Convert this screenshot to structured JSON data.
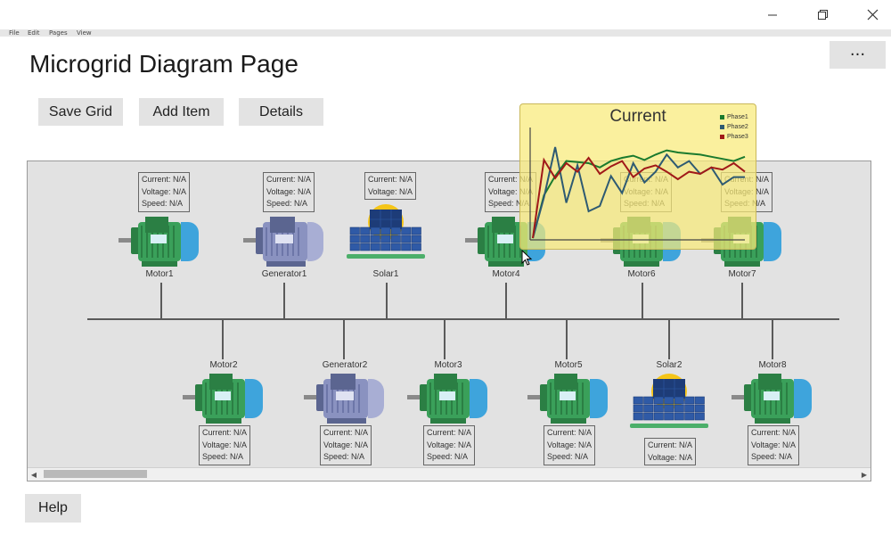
{
  "window": {
    "min_icon": "minimize-icon",
    "max_icon": "restore-icon",
    "close_icon": "close-icon"
  },
  "menu": [
    "File",
    "Edit",
    "Pages",
    "View"
  ],
  "page_title": "Microgrid Diagram Page",
  "toolbar": {
    "save": "Save Grid",
    "add": "Add Item",
    "details": "Details",
    "more": "···"
  },
  "help": "Help",
  "info_labels": {
    "current": "Current: N/A",
    "voltage": "Voltage: N/A",
    "speed": "Speed: N/A"
  },
  "devices_top": [
    {
      "name": "Motor1",
      "kind": "motor"
    },
    {
      "name": "Generator1",
      "kind": "generator"
    },
    {
      "name": "Solar1",
      "kind": "solar"
    },
    {
      "name": "Motor4",
      "kind": "motor"
    },
    {
      "name": "Motor6",
      "kind": "motor"
    },
    {
      "name": "Motor7",
      "kind": "motor"
    }
  ],
  "devices_bottom": [
    {
      "name": "Motor2",
      "kind": "motor"
    },
    {
      "name": "Generator2",
      "kind": "generator"
    },
    {
      "name": "Motor3",
      "kind": "motor"
    },
    {
      "name": "Motor5",
      "kind": "motor"
    },
    {
      "name": "Solar2",
      "kind": "solar"
    },
    {
      "name": "Motor8",
      "kind": "motor"
    }
  ],
  "popup": {
    "title": "Current",
    "colors": {
      "Phase1": "#1a7a2e",
      "Phase2": "#2e5a72",
      "Phase3": "#a01818"
    }
  },
  "chart_data": {
    "type": "line",
    "title": "Current",
    "xlabel": "",
    "ylabel": "",
    "x": [
      0,
      1,
      2,
      3,
      4,
      5,
      6,
      7,
      8,
      9,
      10,
      11,
      12,
      13,
      14,
      15,
      16,
      17,
      18,
      19
    ],
    "series": [
      {
        "name": "Phase1",
        "values": [
          0,
          40,
          58,
          72,
          71,
          70,
          66,
          72,
          75,
          77,
          73,
          78,
          82,
          80,
          79,
          78,
          76,
          74,
          72,
          76
        ]
      },
      {
        "name": "Phase2",
        "values": [
          0,
          38,
          85,
          33,
          68,
          25,
          30,
          58,
          42,
          70,
          52,
          62,
          78,
          66,
          72,
          60,
          66,
          50,
          57,
          57
        ]
      },
      {
        "name": "Phase3",
        "values": [
          0,
          73,
          56,
          70,
          62,
          75,
          60,
          67,
          72,
          57,
          65,
          68,
          62,
          55,
          62,
          60,
          66,
          64,
          70,
          62
        ]
      }
    ],
    "ylim": [
      0,
      100
    ],
    "grid": false,
    "legend": "top-right"
  }
}
